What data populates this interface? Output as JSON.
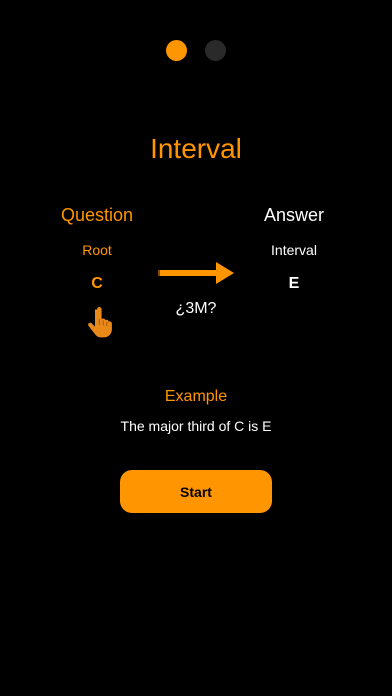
{
  "pager": {
    "pages": 2,
    "current": 1,
    "active_color": "#FF9500",
    "inactive_color": "#2A2A2A"
  },
  "title": "Interval",
  "question": {
    "heading": "Question",
    "sub": "Root",
    "value": "C",
    "icon": "pointing-hand-icon"
  },
  "answer": {
    "heading": "Answer",
    "sub": "Interval",
    "value": "E"
  },
  "prompt": "¿3M?",
  "arrow_icon": "right-arrow-icon",
  "example": {
    "heading": "Example",
    "text": "The major third of C is E"
  },
  "start_label": "Start",
  "colors": {
    "accent": "#FF9500",
    "background": "#000000",
    "text": "#FFFFFF"
  }
}
